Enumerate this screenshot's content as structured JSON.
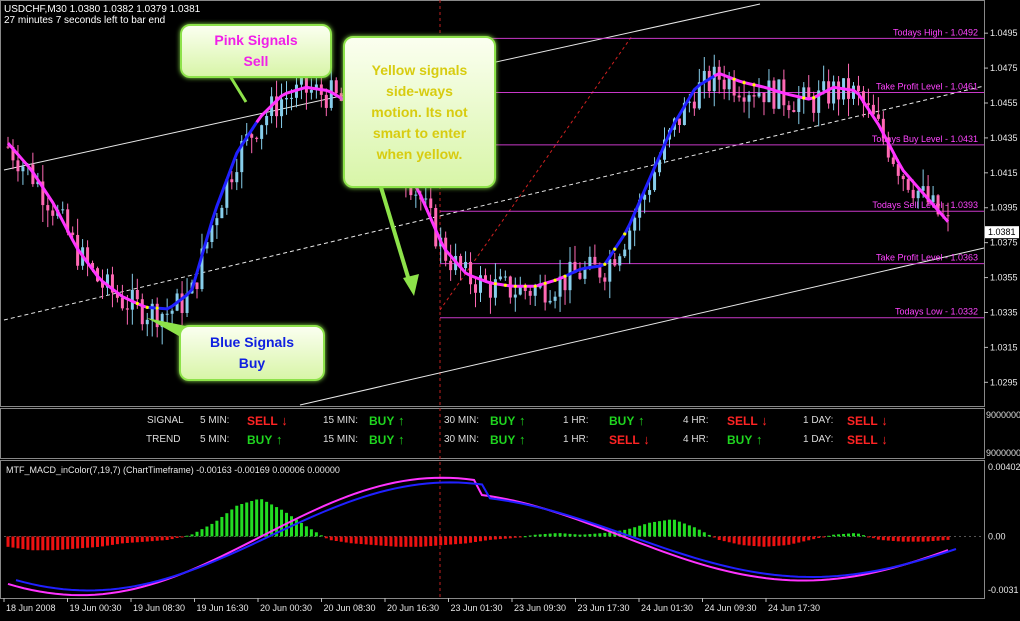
{
  "header": {
    "symbol_line": "USDCHF,M30  1.0380 1.0382 1.0379 1.0381",
    "timer_line": "27 minutes 7 seconds left to bar end"
  },
  "callouts": {
    "pink_line1": "Pink Signals",
    "pink_line2": "Sell",
    "yellow_lines": [
      "Yellow signals",
      "side-ways",
      "motion. Its not",
      "smart to enter",
      "when yellow."
    ],
    "blue_line1": "Blue Signals",
    "blue_line2": "Buy"
  },
  "levels": [
    {
      "label": "Todays High - 1.0492",
      "value": 1.0492
    },
    {
      "label": "Take Profit Level - 1.0461",
      "value": 1.0461
    },
    {
      "label": "Todays Buy Level - 1.0431",
      "value": 1.0431
    },
    {
      "label": "Todays Sell Level - 1.0393",
      "value": 1.0393
    },
    {
      "label": "Take Profit Level - 1.0363",
      "value": 1.0363
    },
    {
      "label": "Todays Low - 1.0332",
      "value": 1.0332
    }
  ],
  "price_axis": {
    "ticks": [
      "1.0495",
      "1.0475",
      "1.0455",
      "1.0435",
      "1.0415",
      "1.0395",
      "1.0375",
      "1.0355",
      "1.0335",
      "1.0315",
      "1.0295"
    ],
    "current": "1.0381"
  },
  "signals": {
    "row1_label": "SIGNAL",
    "row2_label": "TREND",
    "timeframes": [
      "5 MIN:",
      "15 MIN:",
      "30 MIN:",
      "1 HR:",
      "4 HR:",
      "1 DAY:"
    ],
    "signal_values": [
      "SELL",
      "BUY",
      "BUY",
      "BUY",
      "SELL",
      "SELL"
    ],
    "trend_values": [
      "BUY",
      "BUY",
      "BUY",
      "SELL",
      "BUY",
      "SELL"
    ],
    "axis_top": "9000000",
    "axis_bottom": "9000000",
    "colors": {
      "buy": "#1fd51f",
      "sell": "#ff2424"
    }
  },
  "macd": {
    "title": "MTF_MACD_inColor(7,19,7) (ChartTimeframe) -0.00163 -0.00169 0.00006 0.00000",
    "ticks": [
      "0.00402",
      "0.00",
      "-0.0031"
    ]
  },
  "time_axis": {
    "labels": [
      "18 Jun 2008",
      "19 Jun 00:30",
      "19 Jun 08:30",
      "19 Jun 16:30",
      "20 Jun 00:30",
      "20 Jun 08:30",
      "20 Jun 16:30",
      "23 Jun 01:30",
      "23 Jun 09:30",
      "23 Jun 17:30",
      "24 Jun 01:30",
      "24 Jun 09:30",
      "24 Jun 17:30"
    ]
  },
  "colors": {
    "background": "#000000",
    "bull_candle": "#87ceeb",
    "bear_candle": "#ff69b4",
    "ma_sell": "#ff33ff",
    "ma_buy": "#2020ff",
    "side_dots": "#ffff00",
    "level_line": "#c838c8",
    "level_text": "#ff44ff",
    "histogram_up": "#22dd22",
    "histogram_down": "#ee1111"
  },
  "chart_data": {
    "type": "line",
    "series": [
      {
        "values": [
          1.043,
          1.0415,
          1.0395,
          1.037,
          1.0352,
          1.0342,
          1.0336,
          1.0335,
          1.0345,
          1.039,
          1.0425,
          1.0445,
          1.0458,
          1.0462,
          1.046,
          1.0452,
          1.044,
          1.0425,
          1.04,
          1.037,
          1.0355,
          1.035,
          1.0348,
          1.0348,
          1.0352,
          1.0358,
          1.036,
          1.038,
          1.041,
          1.044,
          1.0462,
          1.047,
          1.0465,
          1.0462,
          1.0458,
          1.0455,
          1.0462,
          1.046,
          1.044,
          1.0415,
          1.04,
          1.0385
        ]
      }
    ],
    "macd_histogram": [
      -0.0006,
      -0.0008,
      -0.0008,
      -0.0007,
      -0.0006,
      -0.0004,
      -0.0003,
      -0.0002,
      0.0001,
      0.0008,
      0.0018,
      0.0022,
      0.0015,
      0.0006,
      -0.0002,
      -0.0004,
      -0.0005,
      -0.0006,
      -0.0006,
      -0.0005,
      -0.0004,
      -0.0002,
      -0.0001,
      0.0001,
      0.0002,
      0.0001,
      0.0002,
      0.0004,
      0.0008,
      0.001,
      0.0005,
      -0.0002,
      -0.0005,
      -0.0006,
      -0.0005,
      -0.0002,
      0.0001,
      0.0002,
      -0.0002,
      -0.0003,
      -0.0003,
      -0.0002
    ]
  }
}
